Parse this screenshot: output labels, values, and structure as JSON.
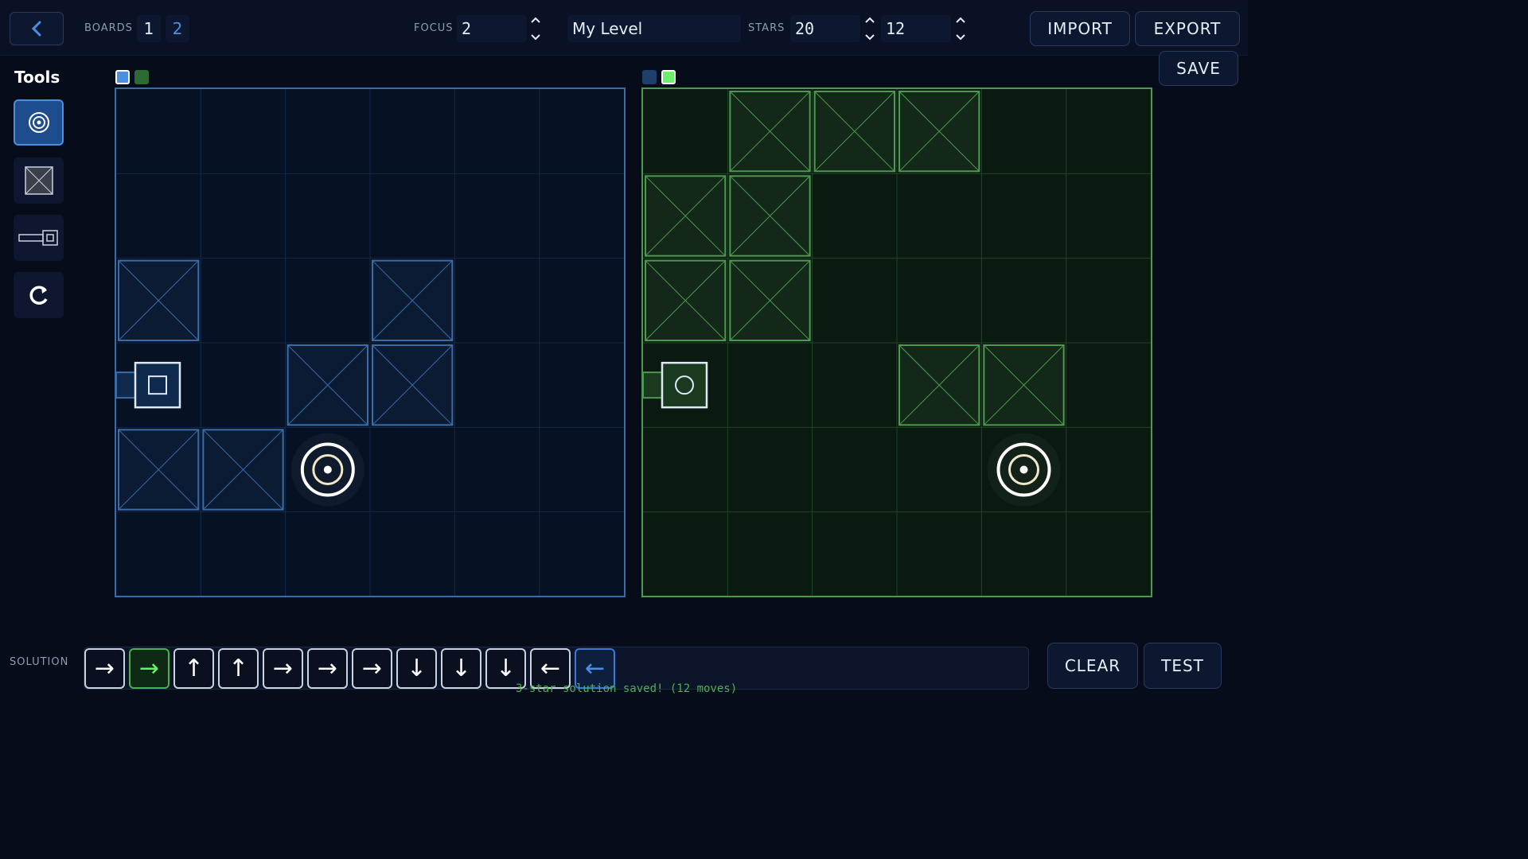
{
  "header": {
    "boards_label": "BOARDS",
    "boards": [
      "1",
      "2"
    ],
    "focus_label": "FOCUS",
    "focus_value": "2",
    "level_name": "My Level",
    "stars_label": "STARS",
    "stars_value": "20",
    "moves_value": "12",
    "import_label": "IMPORT",
    "export_label": "EXPORT",
    "save_label": "SAVE"
  },
  "tools": {
    "title": "Tools",
    "items": [
      "target-tool",
      "block-tool",
      "launcher-tool",
      "rotate-tool"
    ],
    "active": "target-tool"
  },
  "colors": {
    "blue_board": "#3a6da8",
    "green_board": "#4c9a4f",
    "accent_blue": "#4a90e2",
    "accent_green": "#4caf50"
  },
  "boards": [
    {
      "name": "blue",
      "grid": 6,
      "blocks": [
        [
          0,
          2
        ],
        [
          3,
          2
        ],
        [
          2,
          3
        ],
        [
          3,
          3
        ],
        [
          0,
          4
        ],
        [
          1,
          4
        ]
      ],
      "launcher": {
        "col": 0,
        "row": 3,
        "direction": "right"
      },
      "target": {
        "col": 2,
        "row": 4
      }
    },
    {
      "name": "green",
      "grid": 6,
      "blocks": [
        [
          1,
          0
        ],
        [
          2,
          0
        ],
        [
          3,
          0
        ],
        [
          0,
          1
        ],
        [
          1,
          1
        ],
        [
          0,
          2
        ],
        [
          1,
          2
        ],
        [
          3,
          3
        ],
        [
          4,
          3
        ]
      ],
      "launcher": {
        "col": 0,
        "row": 3,
        "direction": "right"
      },
      "target": {
        "col": 4,
        "row": 4
      }
    }
  ],
  "solution": {
    "label": "SOLUTION",
    "moves": [
      "→",
      "→",
      "↑",
      "↑",
      "→",
      "→",
      "→",
      "↓",
      "↓",
      "↓",
      "←",
      "←"
    ],
    "highlight_green_index": 1,
    "highlight_blue_index": 11,
    "status": "3-star solution saved! (12 moves)",
    "clear_label": "CLEAR",
    "test_label": "TEST"
  }
}
